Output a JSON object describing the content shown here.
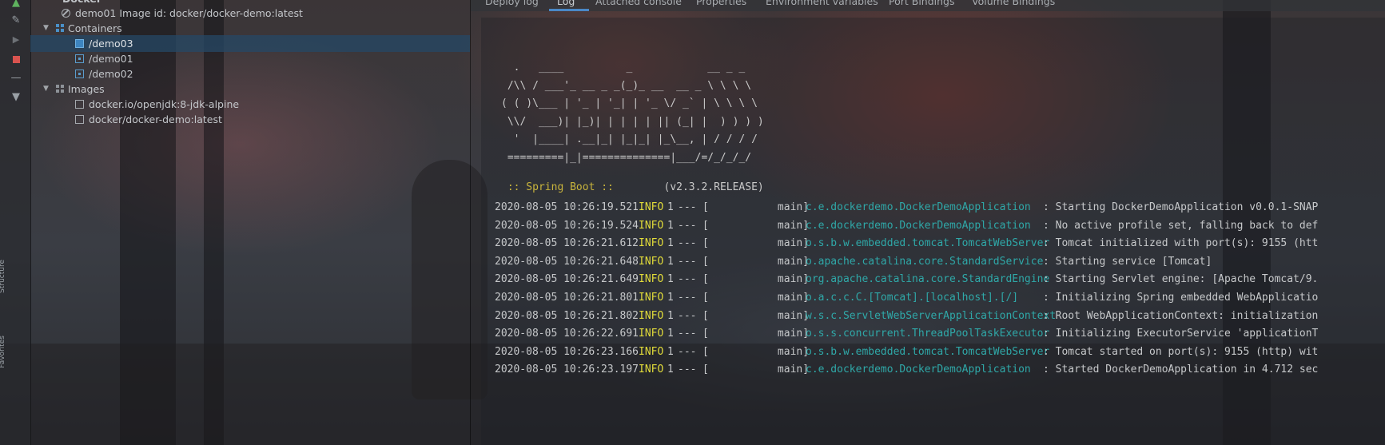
{
  "tree": {
    "top_label": "Docker",
    "container_info": "demo01 Image id: docker/docker-demo:latest",
    "containers_label": "Containers",
    "containers": [
      "/demo03",
      "/demo01",
      "/demo02"
    ],
    "images_label": "Images",
    "images": [
      "docker.io/openjdk:8-jdk-alpine",
      "docker/docker-demo:latest"
    ]
  },
  "side_tabs": [
    "Structure",
    "Favorites"
  ],
  "tabs": [
    "Deploy log",
    "Log",
    "Attached console",
    "Properties",
    "Environment variables",
    "Port Bindings",
    "Volume Bindings"
  ],
  "active_tab": "Log",
  "log": {
    "banner": [
      "  .   ____          _            __ _ _",
      " /\\\\ / ___'_ __ _ _(_)_ __  __ _ \\ \\ \\ \\",
      "( ( )\\___ | '_ | '_| | '_ \\/ _` | \\ \\ \\ \\",
      " \\\\/  ___)| |_)| | | | | || (_| |  ) ) ) )",
      "  '  |____| .__|_| |_|_| |_\\__, | / / / /",
      " =========|_|==============|___/=/_/_/_/"
    ],
    "boot_name": " :: Spring Boot :: ",
    "boot_version": "       (v2.3.2.RELEASE)",
    "lines": [
      {
        "ts": "2020-08-05 10:26:19.521",
        "level": "INFO",
        "pid": "1",
        "sep": "---",
        "thread": "[           main]",
        "logger": "c.e.dockerdemo.DockerDemoApplication",
        "msg": ": Starting DockerDemoApplication v0.0.1-SNAP"
      },
      {
        "ts": "2020-08-05 10:26:19.524",
        "level": "INFO",
        "pid": "1",
        "sep": "---",
        "thread": "[           main]",
        "logger": "c.e.dockerdemo.DockerDemoApplication",
        "msg": ": No active profile set, falling back to def"
      },
      {
        "ts": "2020-08-05 10:26:21.612",
        "level": "INFO",
        "pid": "1",
        "sep": "---",
        "thread": "[           main]",
        "logger": "o.s.b.w.embedded.tomcat.TomcatWebServer",
        "msg": ": Tomcat initialized with port(s): 9155 (htt"
      },
      {
        "ts": "2020-08-05 10:26:21.648",
        "level": "INFO",
        "pid": "1",
        "sep": "---",
        "thread": "[           main]",
        "logger": "o.apache.catalina.core.StandardService",
        "msg": ": Starting service [Tomcat]"
      },
      {
        "ts": "2020-08-05 10:26:21.649",
        "level": "INFO",
        "pid": "1",
        "sep": "---",
        "thread": "[           main]",
        "logger": "org.apache.catalina.core.StandardEngine",
        "msg": ": Starting Servlet engine: [Apache Tomcat/9."
      },
      {
        "ts": "2020-08-05 10:26:21.801",
        "level": "INFO",
        "pid": "1",
        "sep": "---",
        "thread": "[           main]",
        "logger": "o.a.c.c.C.[Tomcat].[localhost].[/]",
        "msg": ": Initializing Spring embedded WebApplicatio"
      },
      {
        "ts": "2020-08-05 10:26:21.802",
        "level": "INFO",
        "pid": "1",
        "sep": "---",
        "thread": "[           main]",
        "logger": "w.s.c.ServletWebServerApplicationContext",
        "msg": ": Root WebApplicationContext: initialization"
      },
      {
        "ts": "2020-08-05 10:26:22.691",
        "level": "INFO",
        "pid": "1",
        "sep": "---",
        "thread": "[           main]",
        "logger": "o.s.s.concurrent.ThreadPoolTaskExecutor",
        "msg": ": Initializing ExecutorService 'applicationT"
      },
      {
        "ts": "2020-08-05 10:26:23.166",
        "level": "INFO",
        "pid": "1",
        "sep": "---",
        "thread": "[           main]",
        "logger": "o.s.b.w.embedded.tomcat.TomcatWebServer",
        "msg": ": Tomcat started on port(s): 9155 (http) wit"
      },
      {
        "ts": "2020-08-05 10:26:23.197",
        "level": "INFO",
        "pid": "1",
        "sep": "---",
        "thread": "[           main]",
        "logger": "c.e.dockerdemo.DockerDemoApplication",
        "msg": ": Started DockerDemoApplication in 4.712 sec"
      }
    ]
  },
  "colors": {
    "log_level": "#e2dc3a",
    "logger": "#2fa8a8",
    "spring_boot": "#c8b43c",
    "selection": "#264866",
    "tab_accent": "#4a88c7"
  },
  "icons": {
    "toolbar": [
      "deploy-icon",
      "edit-icon",
      "run-icon",
      "stop-icon",
      "collapse-icon",
      "filter-icon"
    ]
  }
}
